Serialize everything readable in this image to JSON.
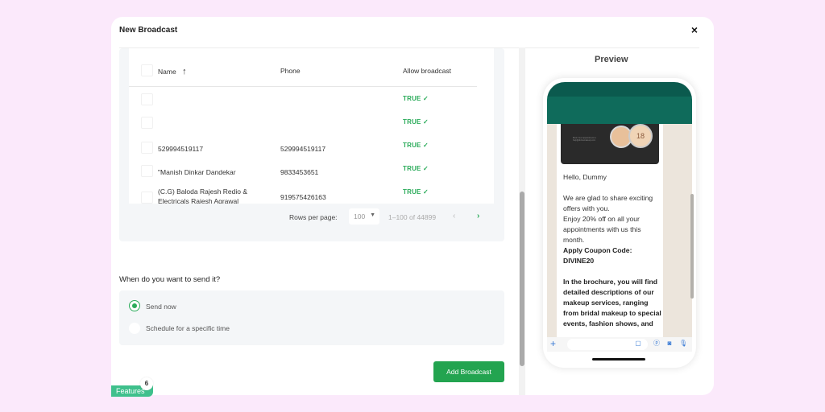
{
  "modal": {
    "title": "New Broadcast",
    "close_icon": "×"
  },
  "table": {
    "columns": [
      "Name",
      "Phone",
      "Allow broadcast"
    ],
    "sort_icon": "↑",
    "rows": [
      {
        "name": "",
        "phone": "",
        "allow": "TRUE"
      },
      {
        "name": "",
        "phone": "",
        "allow": "TRUE"
      },
      {
        "name": "529994519117",
        "phone": "529994519117",
        "allow": "TRUE"
      },
      {
        "name": "\"Manish Dinkar Dandekar",
        "phone": "9833453651",
        "allow": "TRUE"
      },
      {
        "name": "(C.G) Baloda Rajesh Redio & Electricals Rajesh Agrawal",
        "phone": "919575426163",
        "allow": "TRUE"
      }
    ],
    "check_icon": "✓",
    "pagination": {
      "rows_per_page_label": "Rows per page:",
      "rows_per_page_value": "100",
      "range": "1–100 of 44899",
      "prev_icon": "‹",
      "next_icon": "›"
    }
  },
  "schedule": {
    "question": "When do you want to send it?",
    "options": [
      {
        "label": "Send now",
        "selected": true
      },
      {
        "label": "Schedule for a specific time",
        "selected": false
      }
    ]
  },
  "actions": {
    "add_broadcast": "Add Broadcast"
  },
  "preview": {
    "title": "Preview",
    "media_caption": "Book Your Appointment to help@divinemakeup.com",
    "media_badge": "18",
    "greeting": "Hello, Dummy",
    "paragraph1": "We are glad to share exciting offers with you.\nEnjoy 20% off on all your appointments with us this month.",
    "coupon_label": "Apply Coupon Code:",
    "coupon_code": "DIVINE20",
    "paragraph2": "In the brochure, you will find detailed descriptions of our makeup services, ranging from bridal makeup to special events, fashion shows, and"
  },
  "features_tab": {
    "label": "Features",
    "badge_count": "6"
  },
  "colors": {
    "accent_green": "#23a450",
    "whatsapp_header": "#0f6b5b",
    "page_background": "#fbe9fb"
  }
}
